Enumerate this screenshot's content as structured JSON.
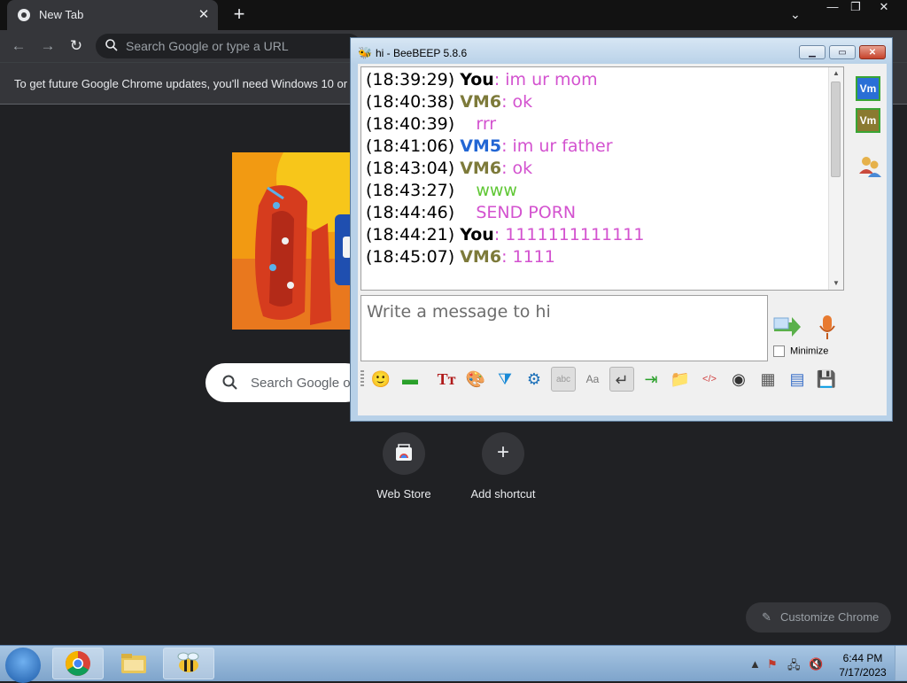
{
  "chrome": {
    "tab_title": "New Tab",
    "omnibox_placeholder": "Search Google or type a URL",
    "infobar_text": "To get future Google Chrome updates, you'll need Windows 10 or",
    "search_placeholder": "Search Google o",
    "shortcuts": [
      {
        "label": "Web Store"
      },
      {
        "label": "Add shortcut"
      }
    ],
    "customize_label": "Customize Chrome"
  },
  "beebeep": {
    "title": "hi - BeeBEEP 5.8.6",
    "messages": [
      {
        "time": "(18:39:29)",
        "nick": "You",
        "text": ": im ur mom"
      },
      {
        "time": "(18:40:38)",
        "nick": "VM6",
        "text": ": ok"
      },
      {
        "time": "(18:40:39)",
        "nick": "",
        "text": "rrr"
      },
      {
        "time": "(18:41:06)",
        "nick": "VM5",
        "text": ": im ur father"
      },
      {
        "time": "(18:43:04)",
        "nick": "VM6",
        "text": ": ok"
      },
      {
        "time": "(18:43:27)",
        "nick": "",
        "text": "www"
      },
      {
        "time": "(18:44:46)",
        "nick": "",
        "text": "SEND PORN"
      },
      {
        "time": "(18:44:21)",
        "nick": "You",
        "text": ": 1111111111111"
      },
      {
        "time": "(18:45:07)",
        "nick": "VM6",
        "text": ": 1111"
      }
    ],
    "input_placeholder": "Write a message to hi",
    "minimize_label": "Minimize",
    "user_badges": [
      "Vm",
      "Vm"
    ],
    "colors": {
      "message": "#d352cf",
      "green_message": "#5fc734",
      "vm6": "#7d7a3a",
      "vm5": "#2266d4"
    }
  },
  "taskbar": {
    "time": "6:44 PM",
    "date": "7/17/2023"
  }
}
